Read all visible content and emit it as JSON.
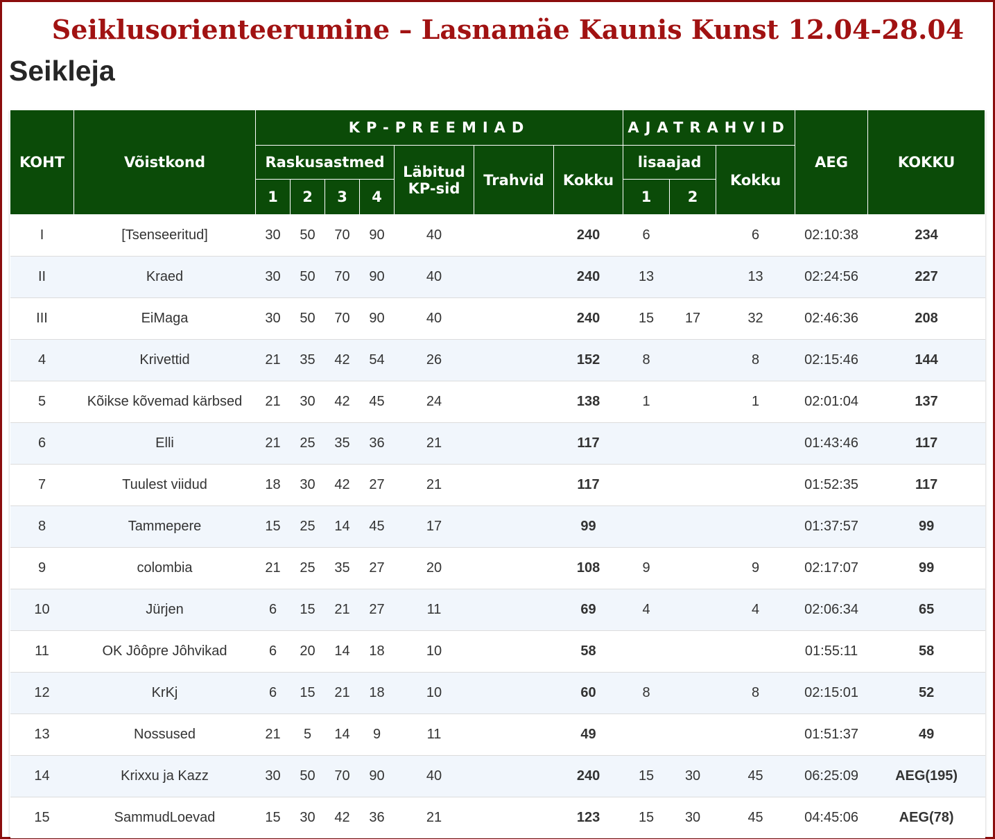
{
  "page": {
    "title": "Seiklusorienteerumine – Lasnamäe Kaunis Kunst 12.04-28.04",
    "subtitle": "Seikleja"
  },
  "headers": {
    "koht": "KOHT",
    "voistkond": "Võistkond",
    "kp_preemiad": "KP-PREEMIAD",
    "ajatrahvid": "AJATRAHVID",
    "aeg": "AEG",
    "kokku_total": "KOKKU",
    "raskusastmed": "Raskusastmed",
    "labitud_kp_sid": "Läbitud KP-sid",
    "trahvid": "Trahvid",
    "kokku_kp": "Kokku",
    "lisaajad": "lisaajad",
    "kokku_aja": "Kokku",
    "r1": "1",
    "r2": "2",
    "r3": "3",
    "r4": "4",
    "l1": "1",
    "l2": "2"
  },
  "rows": [
    {
      "koht": "I",
      "voistkond": "[Tsenseeritud]",
      "r1": "30",
      "r2": "50",
      "r3": "70",
      "r4": "90",
      "labitud": "40",
      "trahvid": "",
      "kp_kokku": "240",
      "l1": "6",
      "l2": "",
      "aja_kokku": "6",
      "aeg": "02:10:38",
      "kokku": "234"
    },
    {
      "koht": "II",
      "voistkond": "Kraed",
      "r1": "30",
      "r2": "50",
      "r3": "70",
      "r4": "90",
      "labitud": "40",
      "trahvid": "",
      "kp_kokku": "240",
      "l1": "13",
      "l2": "",
      "aja_kokku": "13",
      "aeg": "02:24:56",
      "kokku": "227"
    },
    {
      "koht": "III",
      "voistkond": "EiMaga",
      "r1": "30",
      "r2": "50",
      "r3": "70",
      "r4": "90",
      "labitud": "40",
      "trahvid": "",
      "kp_kokku": "240",
      "l1": "15",
      "l2": "17",
      "aja_kokku": "32",
      "aeg": "02:46:36",
      "kokku": "208"
    },
    {
      "koht": "4",
      "voistkond": "Krivettid",
      "r1": "21",
      "r2": "35",
      "r3": "42",
      "r4": "54",
      "labitud": "26",
      "trahvid": "",
      "kp_kokku": "152",
      "l1": "8",
      "l2": "",
      "aja_kokku": "8",
      "aeg": "02:15:46",
      "kokku": "144"
    },
    {
      "koht": "5",
      "voistkond": "Kõikse kõvemad kärbsed",
      "r1": "21",
      "r2": "30",
      "r3": "42",
      "r4": "45",
      "labitud": "24",
      "trahvid": "",
      "kp_kokku": "138",
      "l1": "1",
      "l2": "",
      "aja_kokku": "1",
      "aeg": "02:01:04",
      "kokku": "137"
    },
    {
      "koht": "6",
      "voistkond": "Elli",
      "r1": "21",
      "r2": "25",
      "r3": "35",
      "r4": "36",
      "labitud": "21",
      "trahvid": "",
      "kp_kokku": "117",
      "l1": "",
      "l2": "",
      "aja_kokku": "",
      "aeg": "01:43:46",
      "kokku": "117"
    },
    {
      "koht": "7",
      "voistkond": "Tuulest viidud",
      "r1": "18",
      "r2": "30",
      "r3": "42",
      "r4": "27",
      "labitud": "21",
      "trahvid": "",
      "kp_kokku": "117",
      "l1": "",
      "l2": "",
      "aja_kokku": "",
      "aeg": "01:52:35",
      "kokku": "117"
    },
    {
      "koht": "8",
      "voistkond": "Tammepere",
      "r1": "15",
      "r2": "25",
      "r3": "14",
      "r4": "45",
      "labitud": "17",
      "trahvid": "",
      "kp_kokku": "99",
      "l1": "",
      "l2": "",
      "aja_kokku": "",
      "aeg": "01:37:57",
      "kokku": "99"
    },
    {
      "koht": "9",
      "voistkond": "colombia",
      "r1": "21",
      "r2": "25",
      "r3": "35",
      "r4": "27",
      "labitud": "20",
      "trahvid": "",
      "kp_kokku": "108",
      "l1": "9",
      "l2": "",
      "aja_kokku": "9",
      "aeg": "02:17:07",
      "kokku": "99"
    },
    {
      "koht": "10",
      "voistkond": "Jürjen",
      "r1": "6",
      "r2": "15",
      "r3": "21",
      "r4": "27",
      "labitud": "11",
      "trahvid": "",
      "kp_kokku": "69",
      "l1": "4",
      "l2": "",
      "aja_kokku": "4",
      "aeg": "02:06:34",
      "kokku": "65"
    },
    {
      "koht": "11",
      "voistkond": "OK Jôôpre Jôhvikad",
      "r1": "6",
      "r2": "20",
      "r3": "14",
      "r4": "18",
      "labitud": "10",
      "trahvid": "",
      "kp_kokku": "58",
      "l1": "",
      "l2": "",
      "aja_kokku": "",
      "aeg": "01:55:11",
      "kokku": "58"
    },
    {
      "koht": "12",
      "voistkond": "KrKj",
      "r1": "6",
      "r2": "15",
      "r3": "21",
      "r4": "18",
      "labitud": "10",
      "trahvid": "",
      "kp_kokku": "60",
      "l1": "8",
      "l2": "",
      "aja_kokku": "8",
      "aeg": "02:15:01",
      "kokku": "52"
    },
    {
      "koht": "13",
      "voistkond": "Nossused",
      "r1": "21",
      "r2": "5",
      "r3": "14",
      "r4": "9",
      "labitud": "11",
      "trahvid": "",
      "kp_kokku": "49",
      "l1": "",
      "l2": "",
      "aja_kokku": "",
      "aeg": "01:51:37",
      "kokku": "49"
    },
    {
      "koht": "14",
      "voistkond": "Krixxu ja Kazz",
      "r1": "30",
      "r2": "50",
      "r3": "70",
      "r4": "90",
      "labitud": "40",
      "trahvid": "",
      "kp_kokku": "240",
      "l1": "15",
      "l2": "30",
      "aja_kokku": "45",
      "aeg": "06:25:09",
      "kokku": "AEG(195)"
    },
    {
      "koht": "15",
      "voistkond": "SammudLoevad",
      "r1": "15",
      "r2": "30",
      "r3": "42",
      "r4": "36",
      "labitud": "21",
      "trahvid": "",
      "kp_kokku": "123",
      "l1": "15",
      "l2": "30",
      "aja_kokku": "45",
      "aeg": "04:45:06",
      "kokku": "AEG(78)"
    }
  ]
}
